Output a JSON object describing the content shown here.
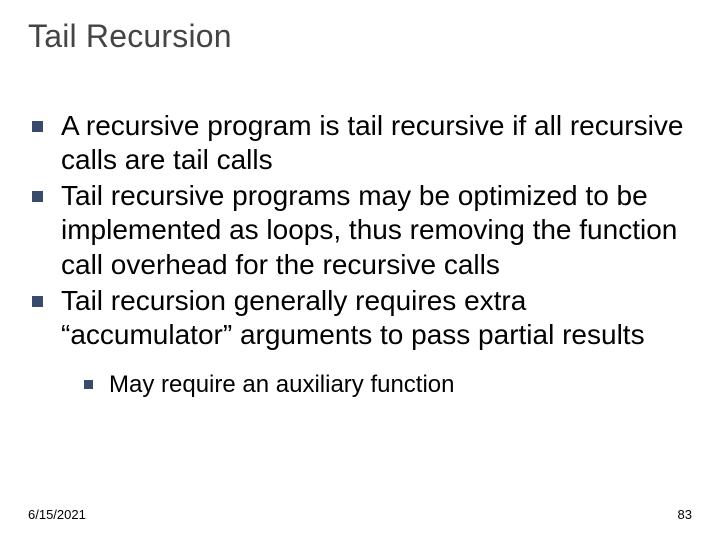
{
  "slide": {
    "title": "Tail Recursion",
    "bullets": [
      {
        "text": "A recursive program is tail recursive if all recursive calls are tail calls"
      },
      {
        "text": "Tail recursive programs may be optimized to be implemented as loops, thus removing the function call overhead for the recursive calls"
      },
      {
        "text": "Tail recursion generally requires extra “accumulator” arguments to pass partial results"
      }
    ],
    "sub_bullets": [
      {
        "text": "May require an auxiliary function"
      }
    ],
    "footer": {
      "date": "6/15/2021",
      "page": "83"
    }
  }
}
